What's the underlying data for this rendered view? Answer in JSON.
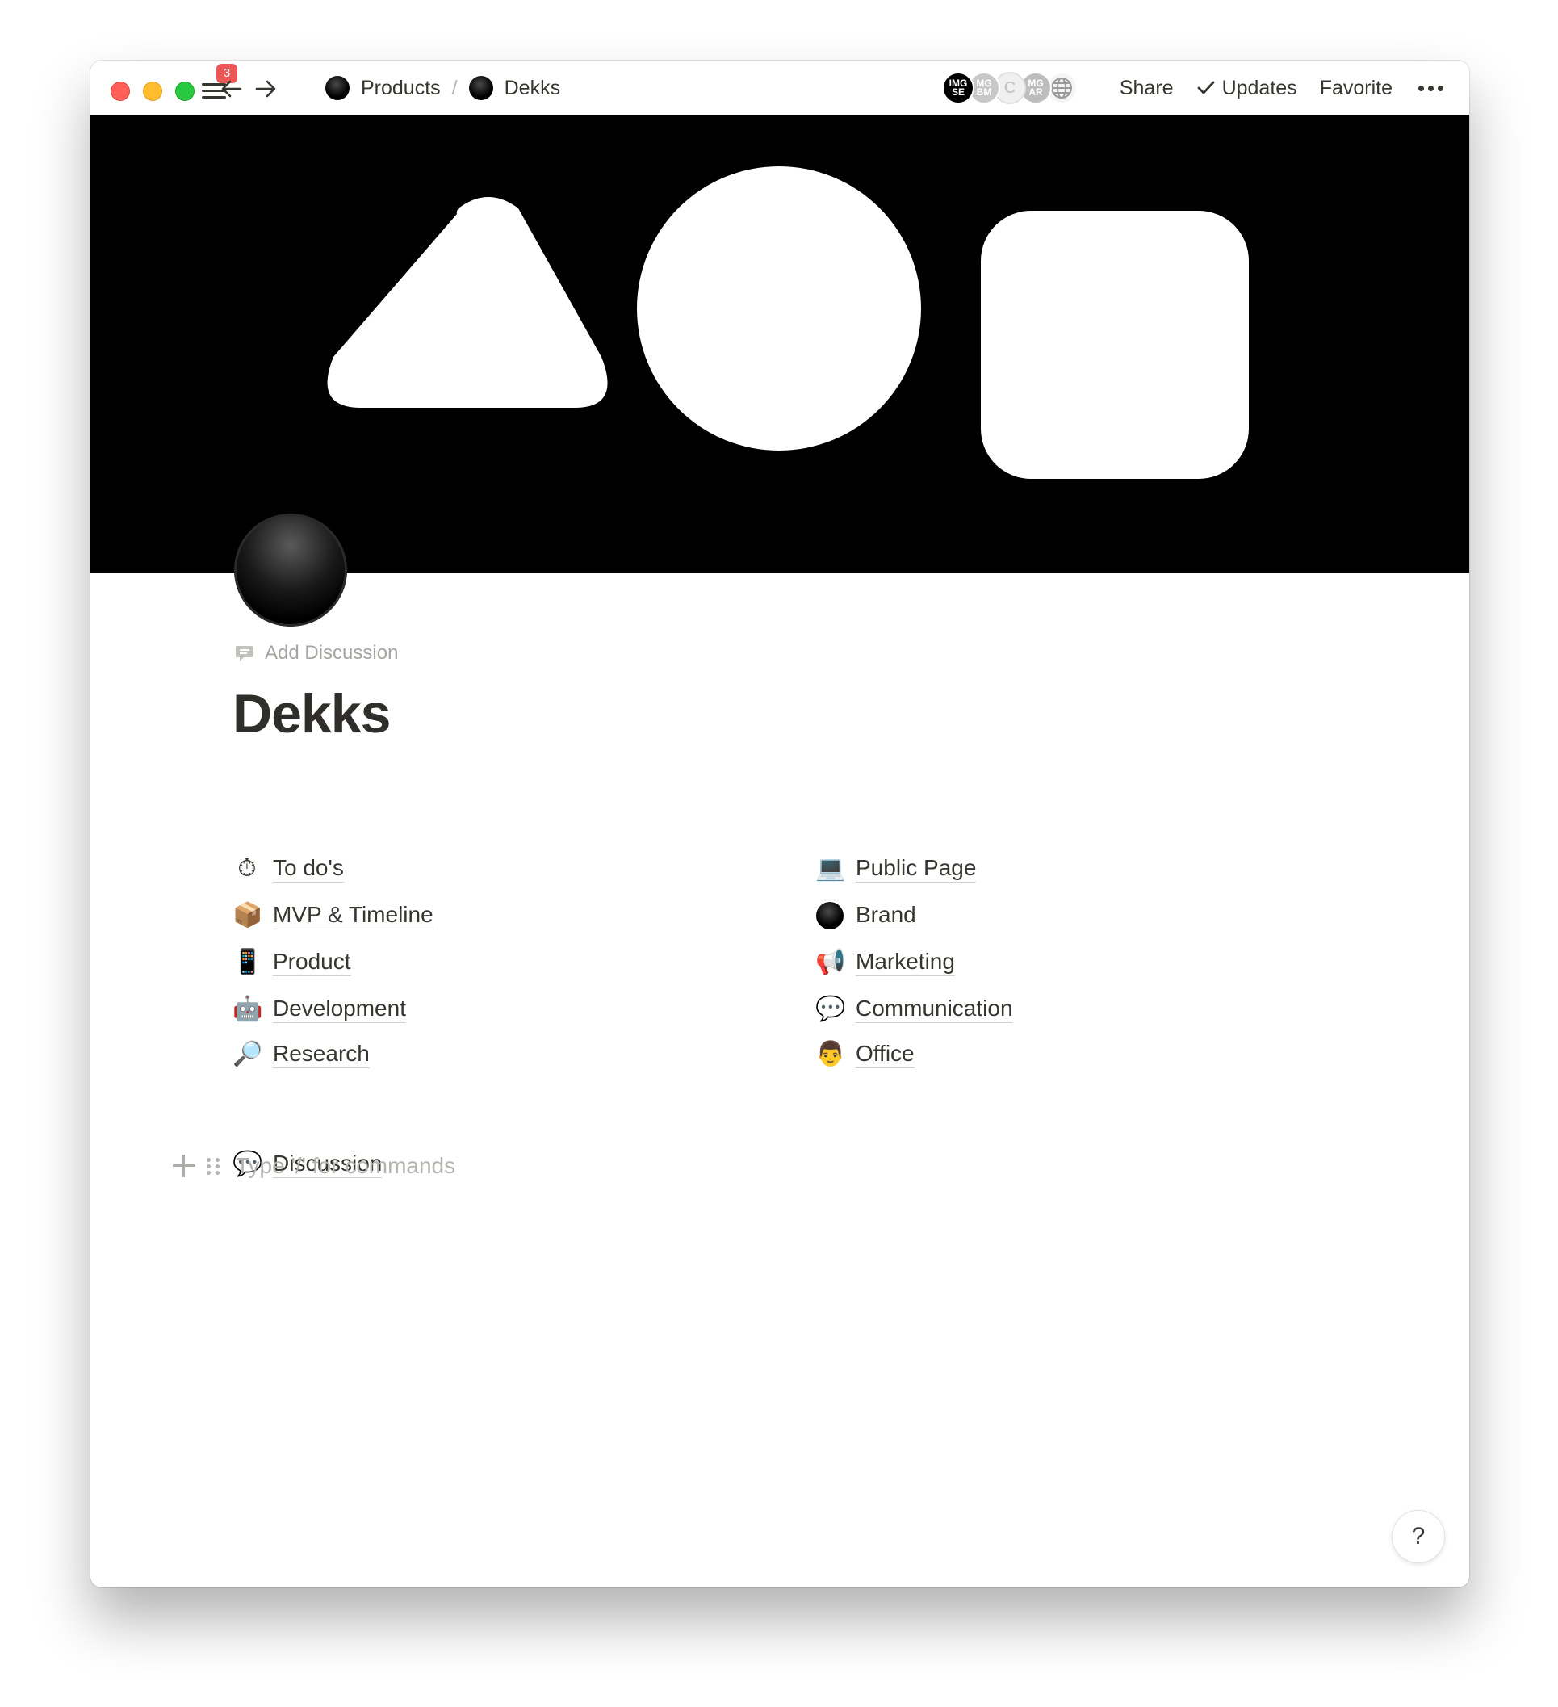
{
  "topbar": {
    "notification_count": "3",
    "breadcrumb": [
      {
        "label": "Products",
        "icon": "black-circle-icon"
      },
      {
        "label": "Dekks",
        "icon": "black-circle-icon"
      }
    ],
    "breadcrumb_separator": "/",
    "avatars": [
      "IMG SE",
      "MG BM",
      "C",
      "MG AR",
      "globe-icon"
    ],
    "actions": {
      "share": "Share",
      "updates": "Updates",
      "favorite": "Favorite"
    }
  },
  "cover": {
    "background_color": "#000000",
    "shapes": [
      "triangle",
      "circle",
      "rounded-square"
    ],
    "shape_color": "#ffffff"
  },
  "page": {
    "icon": "black-circle-icon",
    "add_discussion": "Add Discussion",
    "title": "Dekks",
    "left_links": [
      {
        "emoji": "⏱",
        "icon": "stopwatch-icon",
        "label": "To do's"
      },
      {
        "emoji": "📦",
        "icon": "package-icon",
        "label": "MVP & Timeline"
      },
      {
        "emoji": "📱",
        "icon": "phone-icon",
        "label": "Product"
      },
      {
        "emoji": "🤖",
        "icon": "robot-icon",
        "label": "Development"
      },
      {
        "emoji": "🔎",
        "icon": "magnifier-icon",
        "label": "Research"
      }
    ],
    "right_links": [
      {
        "emoji": "💻",
        "icon": "laptop-icon",
        "label": "Public Page"
      },
      {
        "emoji": "●",
        "icon": "black-circle-icon",
        "label": "Brand"
      },
      {
        "emoji": "📢",
        "icon": "megaphone-icon",
        "label": "Marketing"
      },
      {
        "emoji": "💬",
        "icon": "speech-bubble-icon",
        "label": "Communication"
      },
      {
        "emoji": "👨",
        "icon": "office-worker-icon",
        "label": "Office"
      }
    ],
    "discussion_link": {
      "emoji": "💬",
      "icon": "speech-bubble-icon",
      "label": "Discussion"
    },
    "command_placeholder": "Type '/' for commands"
  },
  "help_label": "?"
}
